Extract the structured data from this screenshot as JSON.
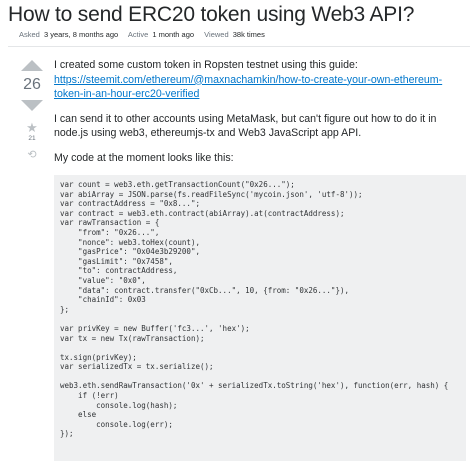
{
  "question": {
    "title": "How to send ERC20 token using Web3 API?",
    "asked_label": "Asked",
    "asked_value": "3 years, 8 months ago",
    "active_label": "Active",
    "active_value": "1 month ago",
    "viewed_label": "Viewed",
    "viewed_value": "38k times"
  },
  "votes": {
    "count": "26",
    "favorites": "21"
  },
  "icons": {
    "upvote": "arrow-up-icon",
    "downvote": "arrow-down-icon",
    "favorite": "star-icon",
    "history": "history-icon"
  },
  "body": {
    "p1_text": "I created some custom token in Ropsten testnet using this guide:",
    "p1_link": "https://steemit.com/ethereum/@maxnachamkin/how-to-create-your-own-ethereum-token-in-an-hour-erc20-verified",
    "p2": "I can send it to other accounts using MetaMask, but can't figure out how to do it in node.js using web3, ethereumjs-tx and Web3 JavaScript app API.",
    "p3": "My code at the moment looks like this:"
  },
  "code_lines": [
    "var count = web3.eth.getTransactionCount(\"0x26...\");",
    "var abiArray = JSON.parse(fs.readFileSync('mycoin.json', 'utf-8'));",
    "var contractAddress = \"0x8...\";",
    "var contract = web3.eth.contract(abiArray).at(contractAddress);",
    "var rawTransaction = {",
    "    \"from\": \"0x26...\",",
    "    \"nonce\": web3.toHex(count),",
    "    \"gasPrice\": \"0x04e3b29200\",",
    "    \"gasLimit\": \"0x7458\",",
    "    \"to\": contractAddress,",
    "    \"value\": \"0x0\",",
    "    \"data\": contract.transfer(\"0xCb...\", 10, {from: \"0x26...\"}),",
    "    \"chainId\": 0x03",
    "};",
    "",
    "var privKey = new Buffer('fc3...', 'hex');",
    "var tx = new Tx(rawTransaction);",
    "",
    "tx.sign(privKey);",
    "var serializedTx = tx.serialize();",
    "",
    "web3.eth.sendRawTransaction('0x' + serializedTx.toString('hex'), function(err, hash) {",
    "    if (!err)",
    "        console.log(hash);",
    "    else",
    "        console.log(err);",
    "});"
  ]
}
